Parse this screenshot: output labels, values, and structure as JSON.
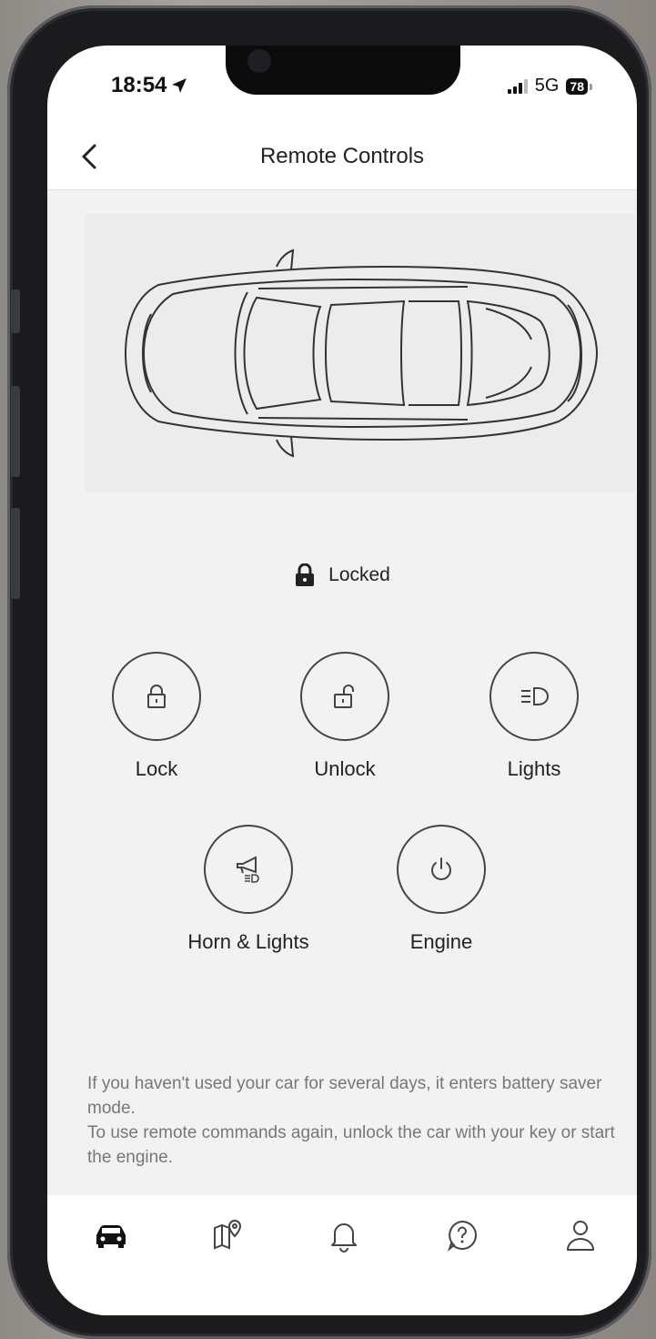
{
  "status_bar": {
    "time": "18:54",
    "network": "5G",
    "battery": "78"
  },
  "header": {
    "title": "Remote Controls"
  },
  "vehicle": {
    "lock_status": "Locked"
  },
  "controls": [
    {
      "label": "Lock",
      "icon": "lock-closed-icon"
    },
    {
      "label": "Unlock",
      "icon": "lock-open-icon"
    },
    {
      "label": "Lights",
      "icon": "headlight-icon"
    },
    {
      "label": "Horn & Lights",
      "icon": "horn-icon"
    },
    {
      "label": "Engine",
      "icon": "power-icon"
    }
  ],
  "info": {
    "line1": "If you haven't used your car for several days, it enters battery saver mode.",
    "line2": "To use remote commands again, unlock the car with your key or start the engine."
  },
  "tabs": [
    {
      "name": "vehicle",
      "icon": "car-icon"
    },
    {
      "name": "map",
      "icon": "map-pin-icon"
    },
    {
      "name": "notifications",
      "icon": "bell-icon"
    },
    {
      "name": "help",
      "icon": "help-icon"
    },
    {
      "name": "profile",
      "icon": "user-icon"
    }
  ],
  "colors": {
    "icon_stroke": "#444444",
    "content_bg": "#f2f2f2",
    "active_tab": "#111111"
  }
}
